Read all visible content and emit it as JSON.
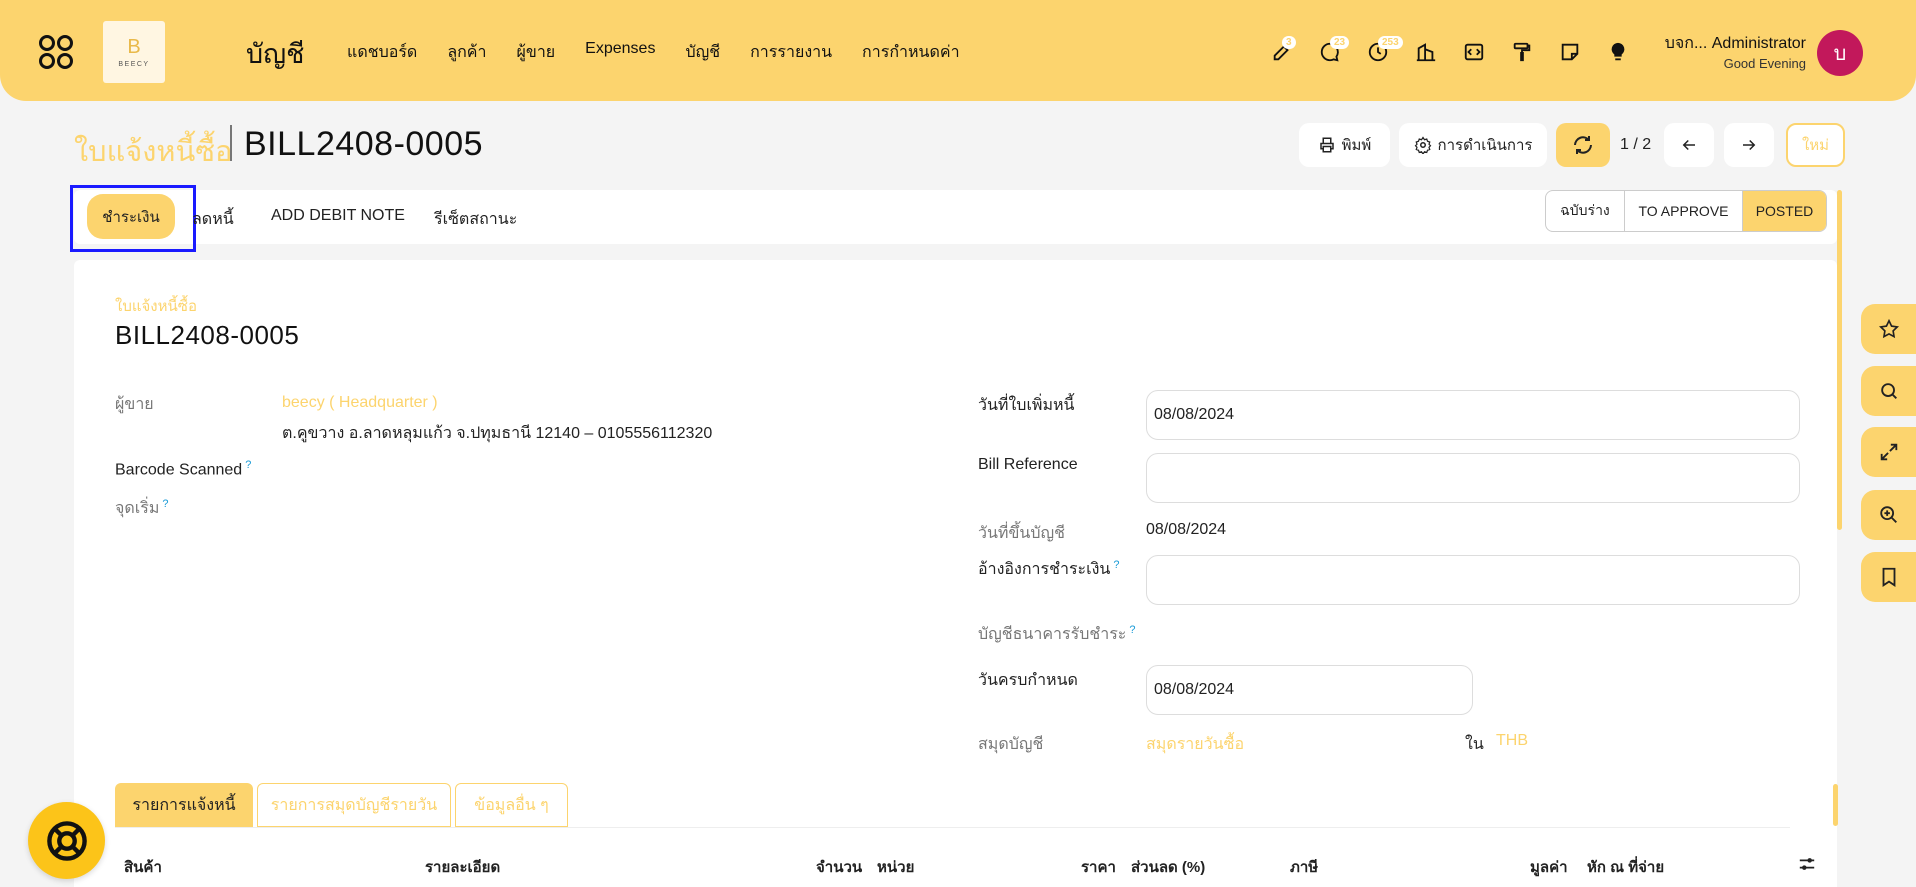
{
  "nav": {
    "app_title": "บัญชี",
    "logo_letter": "B",
    "logo_text": "BEECY",
    "menu": [
      "แดชบอร์ด",
      "ลูกค้า",
      "ผู้ขาย",
      "Expenses",
      "บัญชี",
      "การรายงาน",
      "การกำหนดค่า"
    ],
    "badges": {
      "activity": "3",
      "messages": "23",
      "clock": "253"
    },
    "user_name": "บจก... Administrator",
    "greeting": "Good Evening",
    "avatar_letter": "บ"
  },
  "header": {
    "breadcrumb_parent": "ใบแจ้งหนี้ซื้อ",
    "breadcrumb_current": "BILL2408-0005",
    "print_label": "พิมพ์",
    "action_label": "การดำเนินการ",
    "pager": "1 / 2",
    "new_label": "ใหม่"
  },
  "actions": {
    "pay": "ชำระเงิน",
    "credit_note": "ลดหนี้",
    "debit_note": "ADD DEBIT NOTE",
    "reset": "รีเซ็ตสถานะ"
  },
  "statusbar": [
    "ฉบับร่าง",
    "TO APPROVE",
    "POSTED"
  ],
  "form": {
    "doc_type": "ใบแจ้งหนี้ซื้อ",
    "doc_number": "BILL2408-0005",
    "vendor_label": "ผู้ขาย",
    "vendor_name": "beecy ( Headquarter )",
    "vendor_address": "ต.คูขวาง อ.ลาดหลุมแก้ว จ.ปทุมธานี 12140 – 0105556112320",
    "barcode_label": "Barcode Scanned",
    "origin_label": "จุดเริ่ม",
    "bill_date_label": "วันที่ใบเพิ่มหนี้",
    "bill_date": "08/08/2024",
    "bill_ref_label": "Bill Reference",
    "bill_ref": "",
    "accounting_date_label": "วันที่ขึ้นบัญชี",
    "accounting_date": "08/08/2024",
    "payment_ref_label": "อ้างอิงการชำระเงิน",
    "payment_ref": "",
    "bank_label": "บัญชีธนาคารรับชำระ",
    "due_date_label": "วันครบกำหนด",
    "due_date": "08/08/2024",
    "journal_label": "สมุดบัญชี",
    "journal": "สมุดรายวันซื้อ",
    "currency_in": "ใน",
    "currency": "THB"
  },
  "tabs": [
    "รายการแจ้งหนี้",
    "รายการสมุดบัญชีรายวัน",
    "ข้อมูลอื่น ๆ"
  ],
  "table_headers": [
    "สินค้า",
    "รายละเอียด",
    "จำนวน",
    "หน่วย",
    "ราคา",
    "ส่วนลด (%)",
    "ภาษี",
    "มูลค่า",
    "หัก ณ ที่จ่าย"
  ]
}
